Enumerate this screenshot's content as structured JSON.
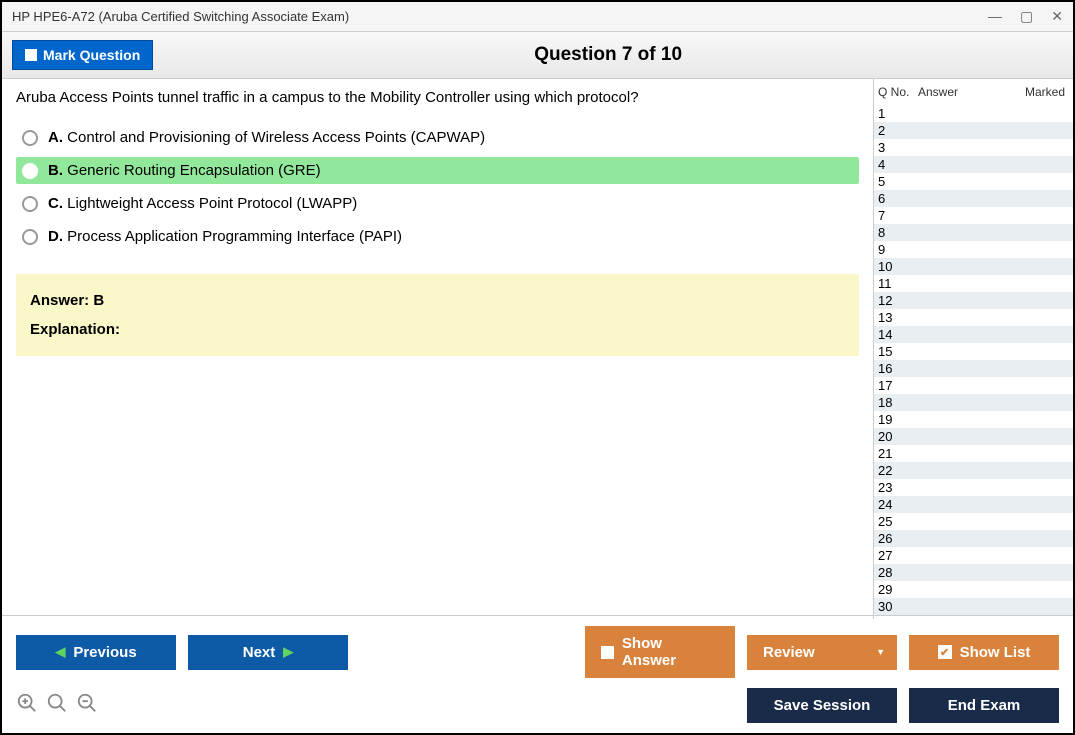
{
  "window": {
    "title": "HP HPE6-A72 (Aruba Certified Switching Associate Exam)"
  },
  "header": {
    "mark_label": "Mark Question",
    "question_title": "Question 7 of 10"
  },
  "question": {
    "text": "Aruba Access Points tunnel traffic in a campus to the Mobility Controller using which protocol?",
    "choices": [
      {
        "letter": "A.",
        "text": "Control and Provisioning of Wireless Access Points (CAPWAP)",
        "correct": false
      },
      {
        "letter": "B.",
        "text": "Generic Routing Encapsulation (GRE)",
        "correct": true
      },
      {
        "letter": "C.",
        "text": "Lightweight Access Point Protocol (LWAPP)",
        "correct": false
      },
      {
        "letter": "D.",
        "text": "Process Application Programming Interface (PAPI)",
        "correct": false
      }
    ],
    "answer_label": "Answer: B",
    "explanation_label": "Explanation:"
  },
  "sidebar": {
    "col_qno": "Q No.",
    "col_answer": "Answer",
    "col_marked": "Marked",
    "rows": [
      1,
      2,
      3,
      4,
      5,
      6,
      7,
      8,
      9,
      10,
      11,
      12,
      13,
      14,
      15,
      16,
      17,
      18,
      19,
      20,
      21,
      22,
      23,
      24,
      25,
      26,
      27,
      28,
      29,
      30
    ]
  },
  "footer": {
    "previous": "Previous",
    "next": "Next",
    "show_answer": "Show Answer",
    "review": "Review",
    "show_list": "Show List",
    "save_session": "Save Session",
    "end_exam": "End Exam"
  }
}
